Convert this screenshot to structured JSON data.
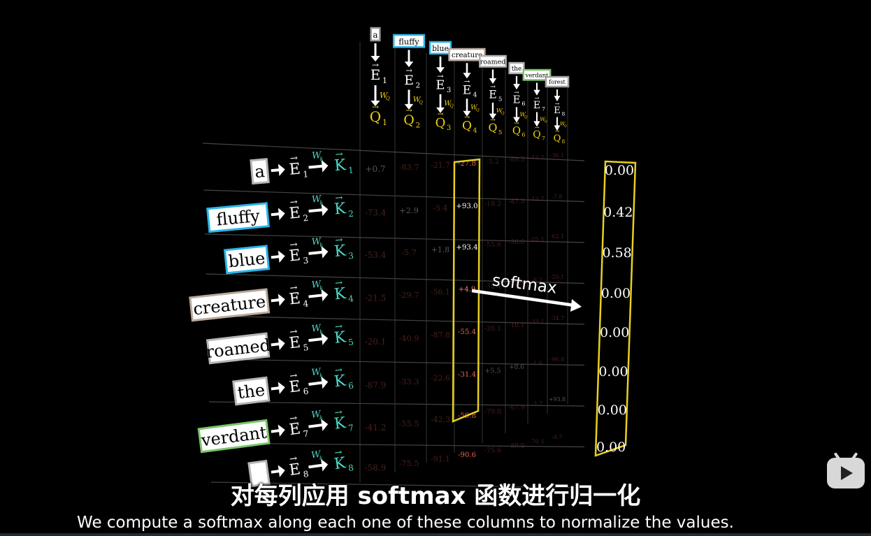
{
  "query_tokens": [
    {
      "label": "a",
      "color": "#9a9a9a",
      "e_sub": "1",
      "q_sub": "1"
    },
    {
      "label": "fluffy",
      "color": "#29b6e8",
      "e_sub": "2",
      "q_sub": "2"
    },
    {
      "label": "blue",
      "color": "#29b6e8",
      "e_sub": "3",
      "q_sub": "3"
    },
    {
      "label": "creature",
      "color": "#b9a99b",
      "e_sub": "4",
      "q_sub": "4"
    },
    {
      "label": "roamed",
      "color": "#b0b0b0",
      "e_sub": "5",
      "q_sub": "5"
    },
    {
      "label": "the",
      "color": "#b0b0b0",
      "e_sub": "6",
      "q_sub": "6"
    },
    {
      "label": "verdant",
      "color": "#7cc66a",
      "e_sub": "7",
      "q_sub": "7"
    },
    {
      "label": "forest",
      "color": "#a0a0a0",
      "e_sub": "8",
      "q_sub": "8"
    }
  ],
  "key_tokens": [
    {
      "label": "a",
      "color": "#b5b5b5",
      "e_sub": "1",
      "k_sub": "1"
    },
    {
      "label": "fluffy",
      "color": "#29b6e8",
      "e_sub": "2",
      "k_sub": "2"
    },
    {
      "label": "blue",
      "color": "#29b6e8",
      "e_sub": "3",
      "k_sub": "3"
    },
    {
      "label": "creature",
      "color": "#b9a99b",
      "e_sub": "4",
      "k_sub": "4"
    },
    {
      "label": "roamed",
      "color": "#b5b5b5",
      "e_sub": "5",
      "k_sub": "5"
    },
    {
      "label": "the",
      "color": "#b5b5b5",
      "e_sub": "6",
      "k_sub": "6"
    },
    {
      "label": "verdant",
      "color": "#7cc66a",
      "e_sub": "7",
      "k_sub": "7"
    },
    {
      "label": "",
      "color": "#b5b5b5",
      "e_sub": "8",
      "k_sub": "8"
    }
  ],
  "symbols": {
    "embedding": "E",
    "query": "Q",
    "key": "K",
    "query_weight": "W",
    "query_weight_sub": "Q",
    "key_weight": "W",
    "key_weight_sub": "k"
  },
  "grid_values": [
    [
      "+0.7",
      "-83.7",
      "-21.7",
      "-27.8",
      "-5.2",
      "-89.3",
      "-13.2",
      "-36.1"
    ],
    [
      "-73.4",
      "+2.9",
      "-5.4",
      "+93.0",
      "-18.2",
      "-87.3",
      "-13.7",
      "-7.8"
    ],
    [
      "-53.4",
      "-5.7",
      "+1.8",
      "+93.4",
      "-55.6",
      "-36.0",
      "-25.1",
      "-62.1"
    ],
    [
      "-21.5",
      "-29.7",
      "-56.1",
      "+4.9",
      "-32.4",
      "-22.3",
      "-8.2",
      "-20.1"
    ],
    [
      "-20.1",
      "-40.9",
      "-87.8",
      "-55.4",
      "-20.1",
      "-10.1",
      "-33.1",
      "-34.7"
    ],
    [
      "-87.9",
      "-33.3",
      "-22.6",
      "-31.4",
      "+5.5",
      "+0.6",
      "-1.6",
      "-96.8"
    ],
    [
      "-41.2",
      "-55.5",
      "-42.3",
      "-59.8",
      "-79.0",
      "-67.9",
      "-3.7",
      "+93.8"
    ],
    [
      "-58.9",
      "-75.5",
      "-91.1",
      "-90.6",
      "-75.6",
      "-89.0",
      "-70.5",
      "-4.7"
    ]
  ],
  "highlighted_column": 3,
  "softmax_label": "softmax",
  "softmax_values": [
    "0.00",
    "0.42",
    "0.58",
    "0.00",
    "0.00",
    "0.00",
    "0.00",
    "0.00"
  ],
  "colors": {
    "query": "#f0d010",
    "key": "#4fd8c4",
    "highlight": "#e8d020",
    "negative": "#e06454",
    "positive": "#ffffff"
  },
  "subtitle_zh": "对每列应用 softmax 函数进行归一化",
  "subtitle_en": "We compute a softmax along each one of these columns to normalize the values.",
  "player_logo": "bilibili-tv-icon"
}
